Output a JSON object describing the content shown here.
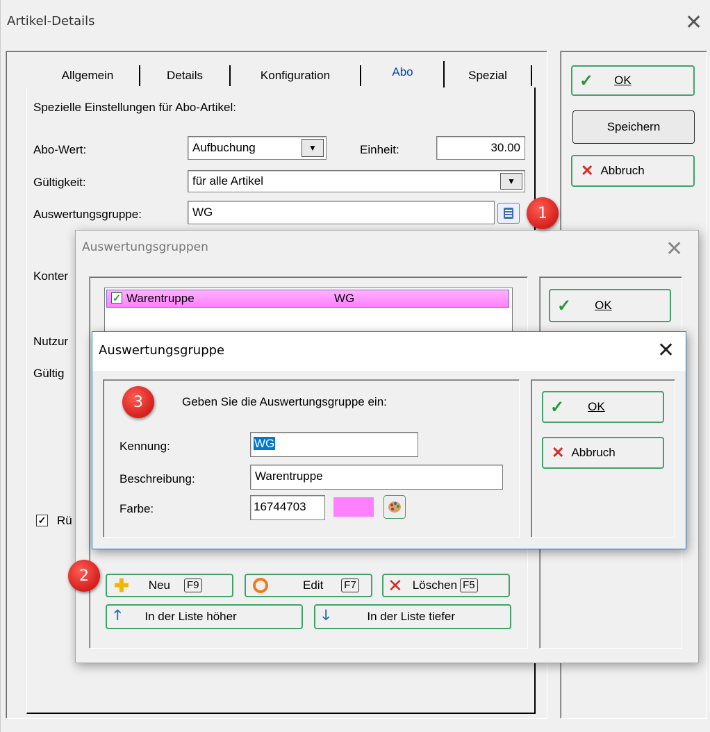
{
  "main_window": {
    "title": "Artikel-Details",
    "tabs": [
      "Allgemein",
      "Details",
      "Konfiguration",
      "Abo",
      "Spezial"
    ],
    "active_tab": "Abo",
    "section_heading": "Spezielle Einstellungen für Abo-Artikel:",
    "abo_wert_label": "Abo-Wert:",
    "abo_wert_value": "Aufbuchung",
    "einheit_label": "Einheit:",
    "einheit_value": "30.00",
    "gueltigkeit_label": "Gültigkeit:",
    "gueltigkeit_value": "für alle Artikel",
    "auswertungsgruppe_label": "Auswertungsgruppe:",
    "auswertungsgruppe_value": "WG",
    "partial_labels": [
      "Konter",
      "Nutzur",
      "Gültig",
      "Rü"
    ],
    "ok_label": "OK",
    "save_label": "Speichern",
    "cancel_label": "Abbruch"
  },
  "groups_dialog": {
    "title": "Auswertungsgruppen",
    "list": [
      {
        "name": "Warentruppe",
        "code": "WG",
        "checked": true,
        "color": "#ff80ff"
      }
    ],
    "ok_label": "OK",
    "new_label": "Neu",
    "new_key": "F9",
    "edit_label": "Edit",
    "edit_key": "F7",
    "delete_label": "Löschen",
    "delete_key": "F5",
    "move_up_label": "In der Liste höher",
    "move_down_label": "In der Liste tiefer"
  },
  "group_dialog": {
    "title": "Auswertungsgruppe",
    "prompt": "Geben Sie die Auswertungsgruppe ein:",
    "kennung_label": "Kennung:",
    "kennung_value": "WG",
    "beschreibung_label": "Beschreibung:",
    "beschreibung_value": "Warentruppe",
    "farbe_label": "Farbe:",
    "farbe_value": "16744703",
    "swatch_color": "#ff80ff",
    "ok_label": "OK",
    "cancel_label": "Abbruch"
  },
  "badges": [
    "1",
    "2",
    "3"
  ],
  "colors": {
    "accent_green": "#3fa36b",
    "highlight": "#0078d7",
    "dialog_border": "#1e7dd3"
  }
}
